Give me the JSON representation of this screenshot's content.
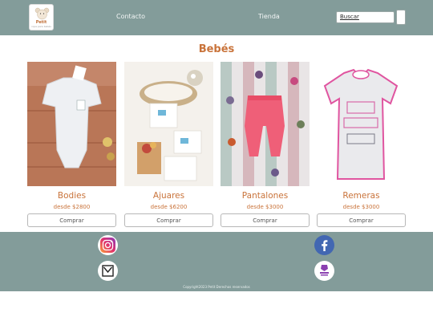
{
  "header": {
    "logo_text": "Petit",
    "logo_sub": "ropa para bebés",
    "nav": {
      "contacto": "Contacto",
      "tienda": "Tienda"
    },
    "search_label": "Buscar"
  },
  "main": {
    "title": "Bebés",
    "products": [
      {
        "name": "Bodies",
        "price": "desde $2800",
        "button": "Comprar"
      },
      {
        "name": "Ajuares",
        "price": "desde $6200",
        "button": "Comprar"
      },
      {
        "name": "Pantalones",
        "price": "desde $3000",
        "button": "Comprar"
      },
      {
        "name": "Remeras",
        "price": "desde $3000",
        "button": "Comprar"
      }
    ]
  },
  "footer": {
    "icons": [
      "instagram-icon",
      "facebook-icon",
      "mail-icon",
      "mercadopago-icon"
    ],
    "copyright": "Copyright2023 Petit Derechos reservados"
  },
  "colors": {
    "header_bg": "#839c9a",
    "accent": "#c9733a",
    "footer_bg": "#839c9a"
  }
}
